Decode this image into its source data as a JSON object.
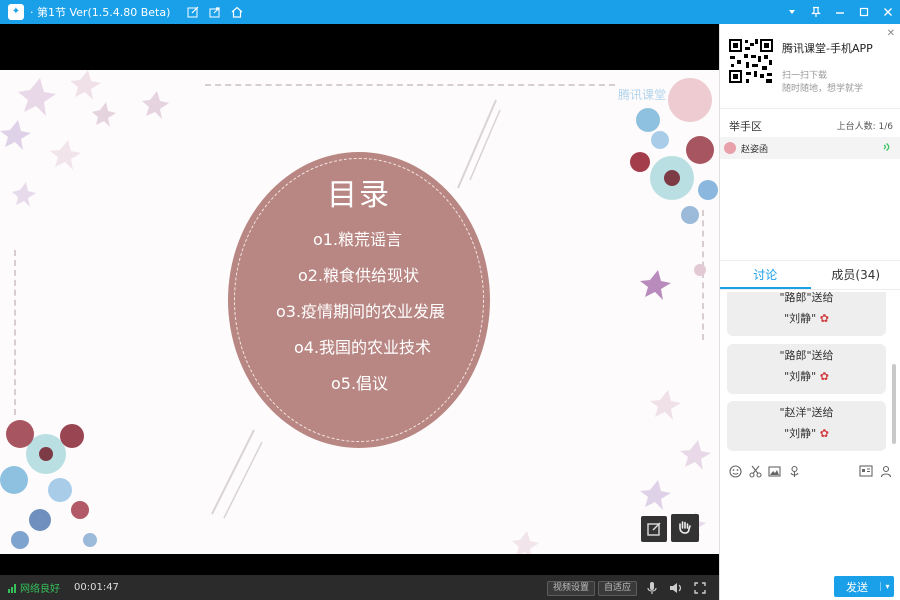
{
  "window": {
    "title": "· 第1节 Ver(1.5.4.80 Beta)"
  },
  "slide": {
    "title": "目录",
    "items": [
      "o1.粮荒谣言",
      "o2.粮食供给现状",
      "o3.疫情期间的农业发展",
      "o4.我国的农业技术",
      "o5.倡议"
    ],
    "watermark": "腾讯课堂"
  },
  "bottom": {
    "network": "网络良好",
    "timer": "00:01:47",
    "video_settings": "视频设置",
    "auto_adapt": "自适应"
  },
  "panel": {
    "app_title": "腾讯课堂-手机APP",
    "scan_text": "扫一扫下载",
    "scan_sub": "随时随地，想学就学",
    "hand_title": "举手区",
    "hand_count": "上台人数: 1/6",
    "hand_user": "赵姿函",
    "tab_discussion": "讨论",
    "tab_members": "成员(34)",
    "messages": [
      {
        "line1": "\"路郎\"送给",
        "line2": "\"刘静\""
      },
      {
        "line1": "\"路郎\"送给",
        "line2": "\"刘静\""
      },
      {
        "line1": "\"赵洋\"送给",
        "line2": "\"刘静\""
      }
    ],
    "send": "发送"
  },
  "colors": {
    "accent": "#1a9fe9",
    "circle": "#b98783",
    "network_ok": "#36c05a"
  }
}
